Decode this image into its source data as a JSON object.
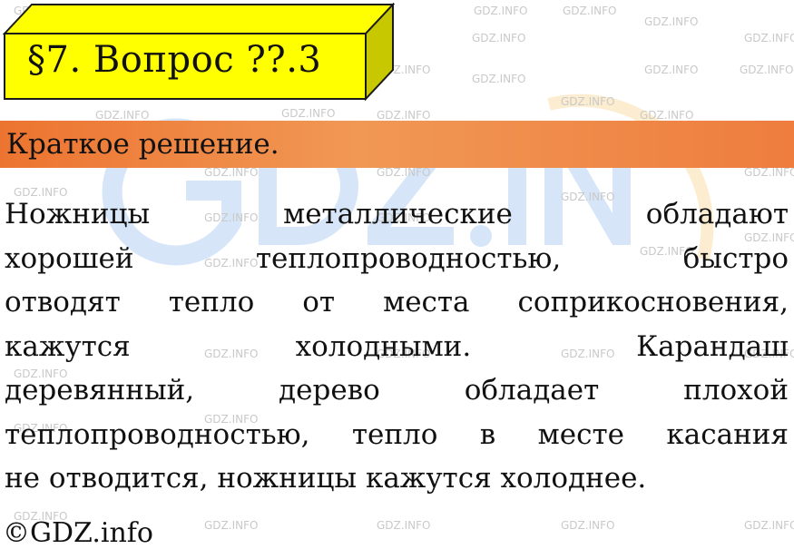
{
  "title": "§7. Вопрос ??.3",
  "section_label": "Краткое решение.",
  "answer_lines": [
    [
      "Ножницы",
      "металлические",
      "обладают"
    ],
    [
      "хорошей",
      "теплопроводностью,",
      "быстро"
    ],
    [
      "отводят",
      "тепло",
      "от",
      "места",
      "соприкосновения,"
    ],
    [
      "кажутся",
      "холодными.",
      "Карандаш"
    ],
    [
      "деревянный,",
      "дерево",
      "обладает",
      "плохой"
    ],
    [
      "теплопроводностью,",
      "тепло",
      "в",
      "месте",
      "касания"
    ],
    [
      "не отводится, ножницы кажутся холоднее."
    ]
  ],
  "copyright": "©GDZ.info",
  "watermark_text": "GDZ.INFO",
  "colors": {
    "title_bg": "#ffff00",
    "title_side": "#c8c800",
    "band": "#ee7d3e"
  }
}
